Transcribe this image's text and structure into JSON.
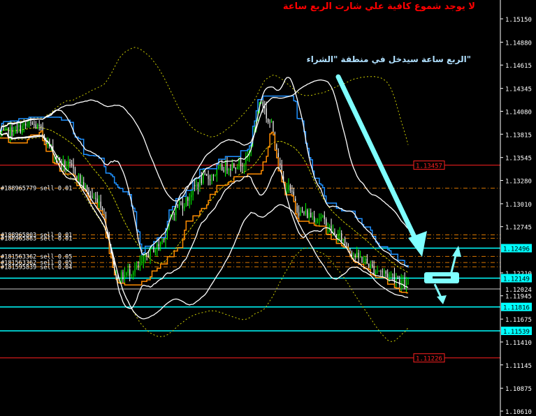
{
  "chart_data": {
    "type": "candlestick",
    "title": "لا يوجد شموع كافية علي شارت الربع ساعة",
    "annotation": "الربع ساعة سيدخل في منطقة \"الشراء\"",
    "y_ticks": [
      1.1515,
      1.1488,
      1.14615,
      1.14345,
      1.1408,
      1.13815,
      1.13545,
      1.1328,
      1.1301,
      1.12745,
      1.1221,
      1.11945,
      1.11675,
      1.1141,
      1.11145,
      1.10875,
      1.1061
    ],
    "y_tick_labels": [
      "1.15150",
      "1.14880",
      "1.14615",
      "1.14345",
      "1.14080",
      "1.13815",
      "1.13545",
      "1.13280",
      "1.13010",
      "1.12745",
      "1.12210",
      "1.11945",
      "1.11675",
      "1.11410",
      "1.11145",
      "1.10875",
      "1.10610"
    ],
    "ylim": [
      1.1059,
      1.1536
    ],
    "price_boxes": [
      {
        "value": 1.12496,
        "label": "1.12496",
        "color": "#00ffff"
      },
      {
        "value": 1.12149,
        "label": "1.12149",
        "color": "#00ffff"
      },
      {
        "value": 1.12024,
        "label": "1.12024",
        "color": "#ffffff"
      },
      {
        "value": 1.11816,
        "label": "1.11816",
        "color": "#00ffff"
      },
      {
        "value": 1.11539,
        "label": "1.11539",
        "color": "#00ffff"
      }
    ],
    "red_levels": [
      {
        "value": 1.13457,
        "label": "1.13457"
      },
      {
        "value": 1.11226,
        "label": "1.11226"
      }
    ],
    "order_labels": [
      {
        "text": "#188965779 sell 0.01",
        "value": 1.1319
      },
      {
        "text": "#188965803 sell 0.01",
        "value": 1.1265
      },
      {
        "text": "#188965883 sell 0.01",
        "value": 1.1261
      },
      {
        "text": "#181563362 sell 0.05",
        "value": 1.124
      },
      {
        "text": "#181563362 sell 0.05",
        "value": 1.1233
      },
      {
        "text": "#181595839 sell 0.04",
        "value": 1.1228
      }
    ],
    "orange_dashed_levels": [
      1.1319,
      1.1265,
      1.1261,
      1.124,
      1.1233,
      1.1228
    ],
    "candle_count": 240,
    "colors": {
      "bullish": "#00ff00",
      "bearish": "#ffffff",
      "bands": "#ffffff",
      "cyan": "#00ffff",
      "blue_channel": "#1e90ff",
      "orange_channel": "#ff8c00",
      "yellow_ma": "#cccc00",
      "red": "#ff2020",
      "title": "#ff0000",
      "annotation": "#b0e0ff",
      "axis_text": "#ffffff"
    }
  }
}
